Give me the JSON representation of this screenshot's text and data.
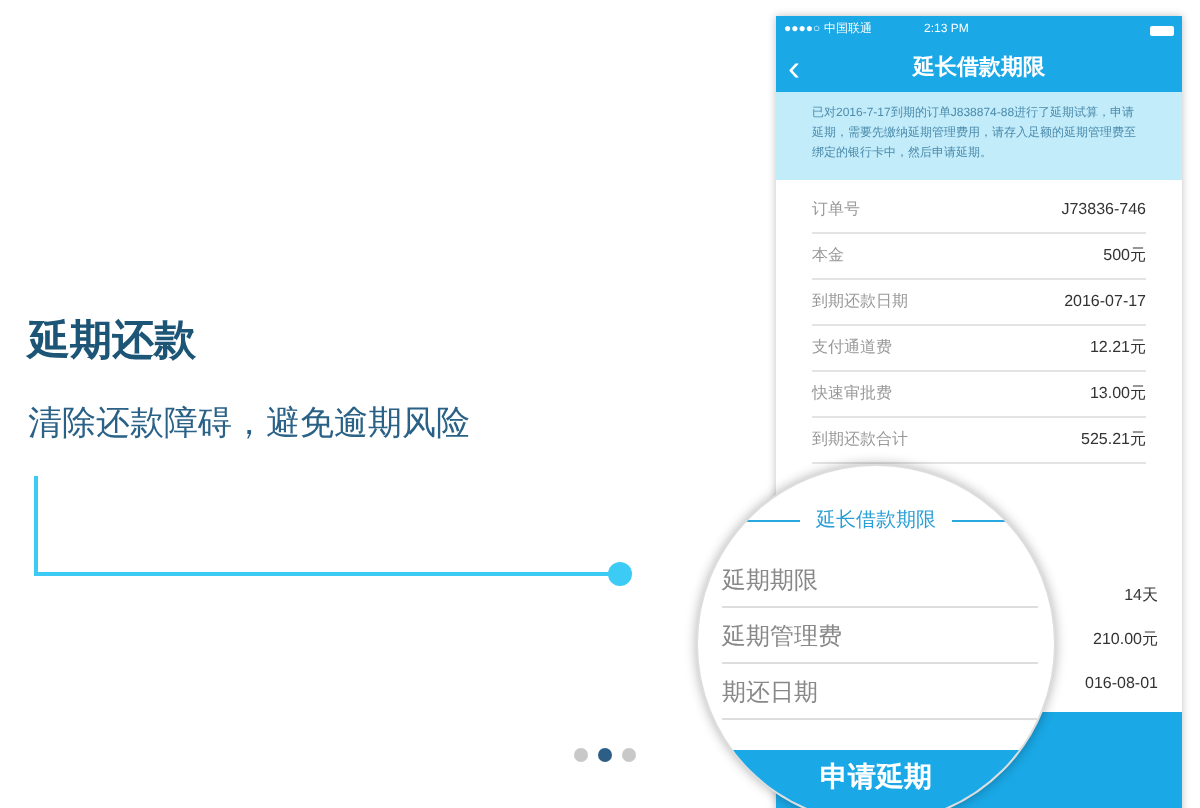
{
  "headline": {
    "title": "延期还款",
    "subtitle": "清除还款障碍，避免逾期风险"
  },
  "carousel": {
    "dots": [
      {
        "selected": false
      },
      {
        "selected": true
      },
      {
        "selected": false
      }
    ]
  },
  "phone": {
    "status_bar": {
      "carrier": "●●●●○ 中国联通",
      "time": "2:13 PM"
    },
    "nav": {
      "back": "‹",
      "title": "延长借款期限"
    },
    "notice": "已对2016-7-17到期的订单J838874-88进行了延期试算，申请延期，需要先缴纳延期管理费用，请存入足额的延期管理费至绑定的银行卡中，然后申请延期。",
    "rows": [
      {
        "label": "订单号",
        "value": "J73836-746"
      },
      {
        "label": "本金",
        "value": "500元"
      },
      {
        "label": "到期还款日期",
        "value": "2016-07-17"
      },
      {
        "label": "支付通道费",
        "value": "12.21元"
      },
      {
        "label": "快速审批费",
        "value": "13.00元"
      },
      {
        "label": "到期还款合计",
        "value": "525.21元"
      }
    ],
    "extension_values": [
      "14天",
      "210.00元",
      "016-08-01"
    ]
  },
  "magnifier": {
    "section_title": "延长借款期限",
    "rows": [
      {
        "label": "延期期限"
      },
      {
        "label": "延期管理费"
      },
      {
        "label": "期还日期"
      }
    ],
    "button": "申请延期"
  }
}
